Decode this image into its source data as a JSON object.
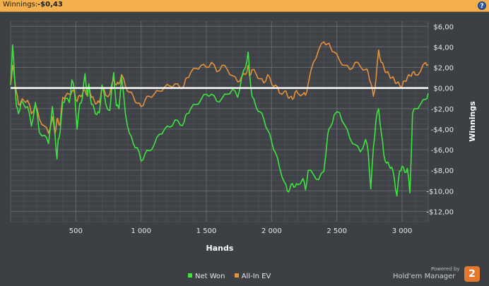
{
  "header": {
    "label": "Winnings:",
    "value": "-$0,43",
    "help": "?"
  },
  "legend": [
    {
      "label": "Net Won",
      "color": "#3de63d"
    },
    {
      "label": "All-In EV",
      "color": "#e8903a"
    }
  ],
  "branding": {
    "powered_by": "Powered by",
    "name": "Hold'em Manager",
    "badge": "2"
  },
  "chart_data": {
    "type": "line",
    "xlabel": "Hands",
    "ylabel": "Winnings",
    "xlim": [
      0,
      3200
    ],
    "ylim": [
      -13,
      6.5
    ],
    "x_ticks": [
      500,
      1000,
      1500,
      2000,
      2500,
      3000
    ],
    "x_tick_labels": [
      "500",
      "1 000",
      "1 500",
      "2 000",
      "2 500",
      "3 000"
    ],
    "y_ticks": [
      6,
      4,
      2,
      0,
      -2,
      -4,
      -6,
      -8,
      -10,
      -12
    ],
    "y_tick_labels": [
      "$6,00",
      "$4,00",
      "$2,00",
      "$0,00",
      "-$2,00",
      "-$4,00",
      "-$6,00",
      "-$8,00",
      "-$10,00",
      "-$12,00"
    ],
    "zero_line": 0,
    "grid": true,
    "series": [
      {
        "name": "Net Won",
        "color": "#3de63d",
        "x": [
          0,
          15,
          30,
          45,
          60,
          80,
          100,
          130,
          160,
          190,
          220,
          260,
          290,
          320,
          340,
          355,
          365,
          380,
          400,
          420,
          450,
          470,
          490,
          510,
          530,
          550,
          570,
          590,
          600,
          620,
          640,
          660,
          680,
          700,
          730,
          760,
          790,
          810,
          830,
          850,
          880,
          910,
          940,
          970,
          1000,
          1030,
          1060,
          1100,
          1140,
          1180,
          1220,
          1260,
          1300,
          1330,
          1350,
          1380,
          1420,
          1460,
          1500,
          1540,
          1580,
          1620,
          1660,
          1700,
          1740,
          1770,
          1800,
          1820,
          1830,
          1850,
          1880,
          1910,
          1940,
          1970,
          2000,
          2030,
          2060,
          2100,
          2120,
          2140,
          2160,
          2180,
          2200,
          2240,
          2260,
          2280,
          2320,
          2360,
          2400,
          2430,
          2450,
          2480,
          2520,
          2560,
          2600,
          2640,
          2680,
          2720,
          2740,
          2760,
          2780,
          2800,
          2820,
          2840,
          2860,
          2880,
          2900,
          2920,
          2940,
          2960,
          2980,
          3000,
          3020,
          3040,
          3060,
          3080,
          3100,
          3140,
          3180,
          3200
        ],
        "values": [
          0.3,
          4.2,
          1.2,
          -1.8,
          -2.5,
          -1.4,
          -1.6,
          -1.8,
          -3.7,
          -1.4,
          -4.3,
          -4.6,
          -5.4,
          -1.8,
          -4.4,
          -6.9,
          -5.0,
          -4.2,
          -1.4,
          -1.0,
          -1.4,
          0.8,
          -0.3,
          -4.0,
          -1.5,
          -1.0,
          1.4,
          -0.8,
          0.4,
          -1.6,
          -2.0,
          -2.6,
          -2.4,
          0.3,
          -1.6,
          -2.2,
          1.5,
          -1.7,
          -2.0,
          1.1,
          -2.5,
          -4.4,
          -5.4,
          -5.8,
          -7.1,
          -6.4,
          -6.1,
          -5.5,
          -4.5,
          -4.0,
          -3.8,
          -3.1,
          -3.6,
          -3.3,
          -2.5,
          -2.0,
          -1.6,
          -1.1,
          -0.6,
          -0.6,
          -1.3,
          -1.0,
          -0.6,
          -0.1,
          -0.9,
          1.0,
          2.0,
          3.5,
          1.6,
          -0.8,
          -1.8,
          -2.3,
          -3.0,
          -4.1,
          -5.2,
          -6.3,
          -7.7,
          -9.2,
          -10.0,
          -9.8,
          -9.3,
          -9.6,
          -9.4,
          -8.8,
          -9.9,
          -8.0,
          -8.4,
          -8.9,
          -8.1,
          -4.5,
          -3.8,
          -2.6,
          -2.4,
          -3.6,
          -4.9,
          -5.5,
          -6.2,
          -5.0,
          -6.2,
          -9.8,
          -5.8,
          -3.1,
          -2.0,
          -4.3,
          -6.5,
          -7.3,
          -7.5,
          -7.7,
          -8.8,
          -10.5,
          -8.1,
          -7.6,
          -8.2,
          -7.8,
          -10.2,
          -2.5,
          -2.0,
          -1.6,
          -1.1,
          -0.5
        ]
      },
      {
        "name": "All-In EV",
        "color": "#e8903a",
        "x": [
          0,
          15,
          30,
          45,
          60,
          80,
          100,
          130,
          160,
          190,
          220,
          260,
          290,
          320,
          340,
          355,
          365,
          380,
          400,
          420,
          450,
          470,
          490,
          510,
          530,
          550,
          570,
          590,
          600,
          620,
          640,
          660,
          680,
          700,
          730,
          760,
          790,
          810,
          830,
          850,
          880,
          910,
          940,
          970,
          1000,
          1030,
          1060,
          1100,
          1140,
          1180,
          1220,
          1260,
          1300,
          1330,
          1350,
          1380,
          1420,
          1460,
          1500,
          1540,
          1580,
          1620,
          1660,
          1700,
          1740,
          1770,
          1800,
          1820,
          1830,
          1850,
          1880,
          1910,
          1940,
          1970,
          2000,
          2030,
          2060,
          2100,
          2120,
          2140,
          2160,
          2180,
          2200,
          2240,
          2260,
          2280,
          2320,
          2360,
          2400,
          2430,
          2450,
          2480,
          2520,
          2560,
          2600,
          2640,
          2680,
          2720,
          2740,
          2760,
          2780,
          2800,
          2820,
          2840,
          2860,
          2880,
          2900,
          2920,
          2940,
          2960,
          2980,
          3000,
          3020,
          3040,
          3060,
          3080,
          3100,
          3140,
          3180,
          3200
        ],
        "values": [
          0.3,
          2.2,
          1.0,
          -0.4,
          -1.6,
          -1.3,
          -1.2,
          -1.2,
          -2.5,
          -1.6,
          -3.0,
          -3.7,
          -4.4,
          -2.8,
          -4.5,
          -3.0,
          -3.3,
          -3.5,
          -0.9,
          -0.8,
          -0.6,
          -0.3,
          -0.5,
          -1.3,
          -0.7,
          -0.6,
          -0.2,
          -0.7,
          0.3,
          -0.9,
          -1.2,
          -1.5,
          -1.4,
          0.1,
          -0.7,
          -0.6,
          0.9,
          0.3,
          0.4,
          1.3,
          0.2,
          -0.4,
          -0.8,
          -1.5,
          -1.8,
          -1.2,
          -0.8,
          -0.6,
          -0.3,
          0.1,
          0.2,
          0.4,
          0.0,
          0.3,
          1.0,
          1.5,
          1.9,
          2.2,
          2.0,
          2.5,
          1.6,
          2.2,
          1.8,
          1.2,
          0.6,
          1.1,
          1.3,
          2.2,
          1.2,
          1.8,
          1.4,
          0.9,
          0.5,
          1.3,
          0.4,
          0.3,
          -0.5,
          -0.3,
          -0.7,
          -0.9,
          -1.1,
          -0.4,
          -0.5,
          -0.6,
          -0.7,
          0.4,
          2.5,
          3.7,
          4.5,
          4.3,
          4.0,
          3.5,
          2.7,
          2.2,
          1.8,
          2.5,
          2.1,
          1.8,
          1.5,
          0.5,
          -0.8,
          0.9,
          3.7,
          2.5,
          2.0,
          1.5,
          1.3,
          1.0,
          0.8,
          0.5,
          0.3,
          0.2,
          0.7,
          1.0,
          1.2,
          1.5,
          1.3,
          1.6,
          2.5,
          2.3
        ]
      }
    ]
  }
}
